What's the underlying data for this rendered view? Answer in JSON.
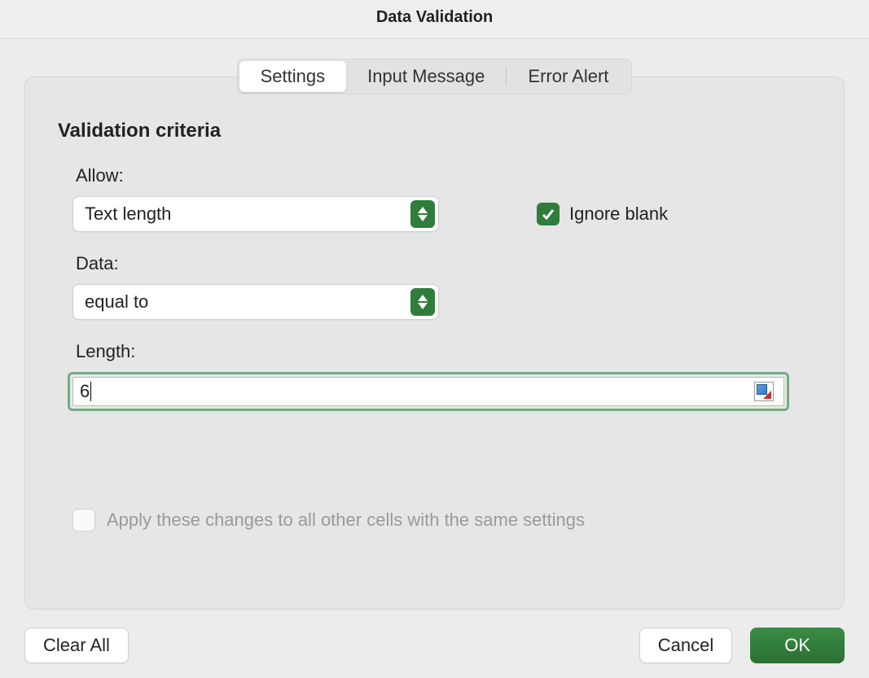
{
  "dialog": {
    "title": "Data Validation",
    "tabs": {
      "settings": "Settings",
      "input_message": "Input Message",
      "error_alert": "Error Alert"
    },
    "section_title": "Validation criteria",
    "fields": {
      "allow_label": "Allow:",
      "allow_value": "Text length",
      "data_label": "Data:",
      "data_value": "equal to",
      "length_label": "Length:",
      "length_value": "6",
      "ignore_blank_checked": true,
      "ignore_blank_label": "Ignore blank",
      "apply_label": "Apply these changes to all other cells with the same settings",
      "apply_checked": false
    },
    "buttons": {
      "clear_all": "Clear All",
      "cancel": "Cancel",
      "ok": "OK"
    }
  }
}
